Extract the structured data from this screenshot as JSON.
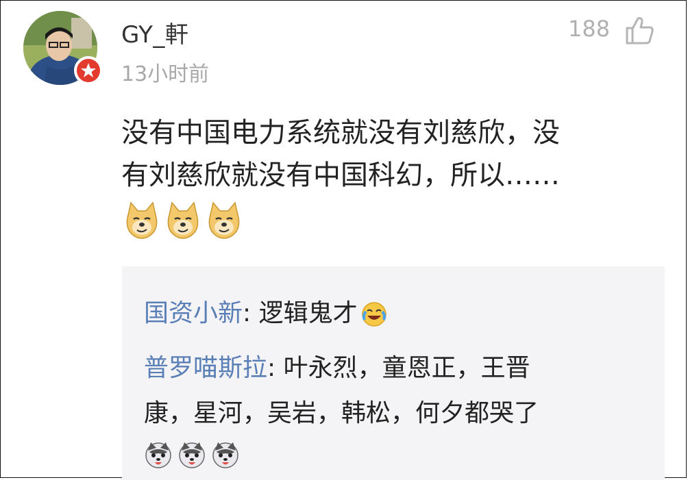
{
  "comment": {
    "username": "GY_軒",
    "time": "13小时前",
    "likes": "188",
    "text_line1": "没有中国电力系统就没有刘慈欣，没",
    "text_line2": "有刘慈欣就没有中国科幻，所以……",
    "emojis": [
      "doge-emoji",
      "doge-emoji",
      "doge-emoji"
    ]
  },
  "replies": [
    {
      "author": "国资小新",
      "separator": ": ",
      "text": "逻辑鬼才",
      "emoji": "laugh-cry-emoji"
    },
    {
      "author": "普罗喵斯拉",
      "separator": ": ",
      "text_line1": "叶永烈，童恩正，王晋",
      "text_line2": "康，星河，吴岩，韩松，何夕都哭了",
      "emojis": [
        "husky-emoji",
        "husky-emoji",
        "husky-emoji"
      ]
    }
  ],
  "colors": {
    "author_link": "#5a7fb6",
    "text": "#222222",
    "meta": "#a8a8a8",
    "badge": "#e33a2e",
    "reply_bg": "#f4f4f6"
  }
}
